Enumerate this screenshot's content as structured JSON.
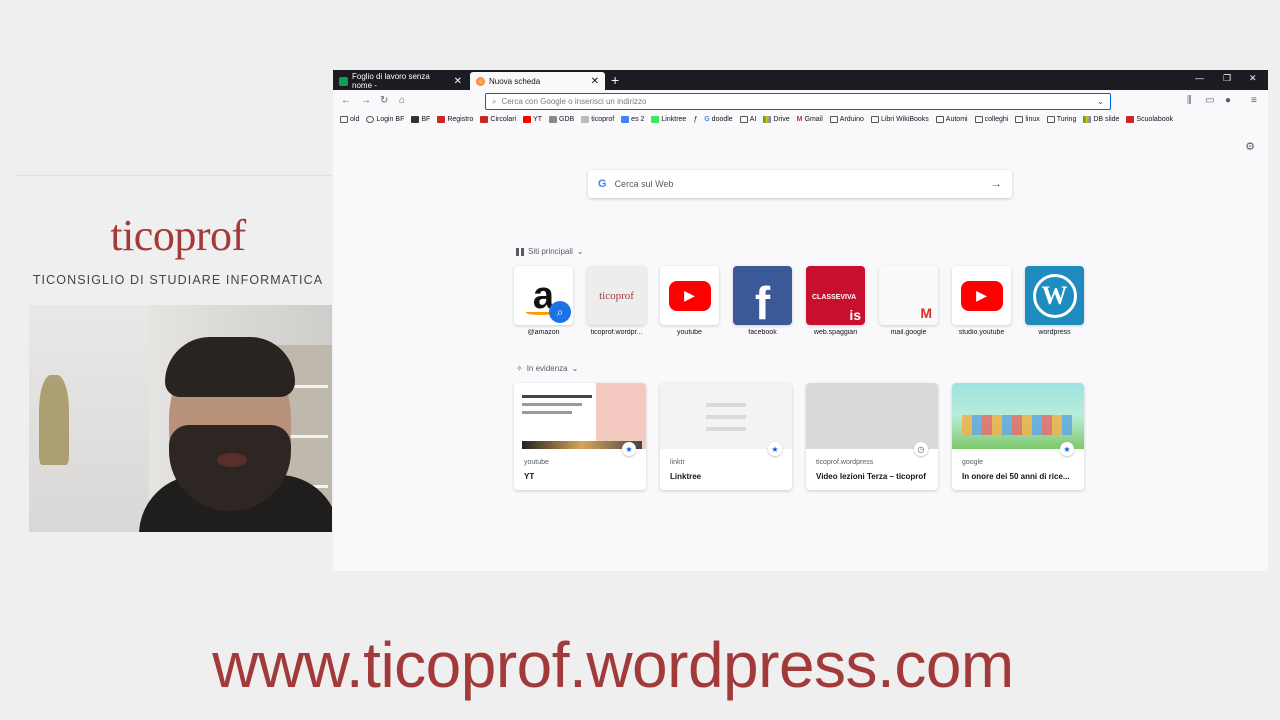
{
  "brand": {
    "title": "ticoprof",
    "subtitle": "TICONSIGLIO DI STUDIARE INFORMATICA",
    "footer_url": "www.ticoprof.wordpress.com"
  },
  "colors": {
    "brand": "#a33a3a",
    "titlebar": "#1c1b22",
    "accent": "#0061e0"
  },
  "browser": {
    "tabs": [
      {
        "label": "Foglio di lavoro senza nome -",
        "icon": "google-sheets-icon",
        "active": false
      },
      {
        "label": "Nuova scheda",
        "icon": "firefox-icon",
        "active": true
      }
    ],
    "urlbar_placeholder": "Cerca con Google o inserisci un indirizzo",
    "bookmarks": [
      "old",
      "Login BF",
      "BF",
      "Registro",
      "Circolari",
      "YT",
      "GDB",
      "ticoprof",
      "es 2",
      "Linktree",
      "",
      "doodle",
      "AI",
      "Drive",
      "Gmail",
      "Arduino",
      "Libri WikiBooks",
      "Automi",
      "colleghi",
      "linux",
      "Turing",
      "DB slide",
      "Scuolabook"
    ]
  },
  "newtab": {
    "search_placeholder": "Cerca sul Web",
    "top_sites_heading": "Siti principali",
    "top_sites": [
      {
        "label": "@amazon"
      },
      {
        "label": "ticoprof.wordpr..."
      },
      {
        "label": "youtube"
      },
      {
        "label": "facebook"
      },
      {
        "label": "web.spaggiari"
      },
      {
        "label": "mail.google"
      },
      {
        "label": "studio.youtube"
      },
      {
        "label": "wordpress"
      }
    ],
    "highlights_heading": "In evidenza",
    "highlights": [
      {
        "source": "youtube",
        "title": "YT"
      },
      {
        "source": "linktr",
        "title": "Linktree"
      },
      {
        "source": "ticoprof.wordpress",
        "title": "Video lezioni Terza – ticoprof"
      },
      {
        "source": "google",
        "title": "In onore dei 50 anni di rice..."
      }
    ]
  }
}
